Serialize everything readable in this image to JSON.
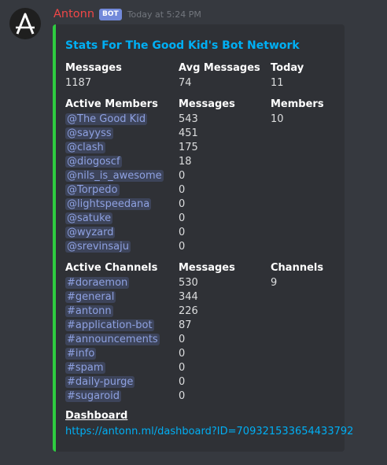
{
  "message": {
    "author": "Antonn",
    "bot_tag": "BOT",
    "timestamp": "Today at 5:24 PM",
    "avatar_icon": "letter-a-avatar-icon"
  },
  "colors": {
    "background": "#36393f",
    "embed_background": "#2f3136",
    "embed_border": "#2ecc40",
    "username": "#f04747",
    "link": "#00aff4",
    "mention": "#8ea1e1"
  },
  "embed": {
    "title": "Stats For The Good Kid's Bot Network",
    "stats": {
      "messages_label": "Messages",
      "messages_value": "1187",
      "avg_label": "Avg Messages",
      "avg_value": "74",
      "today_label": "Today",
      "today_value": "11"
    },
    "members_section": {
      "title": "Active Members",
      "count_header": "Messages",
      "total_label": "Members",
      "total_value": "10",
      "names": [
        "@The Good Kid",
        "@sayyss",
        "@clash",
        "@diogoscf",
        "@nils_is_awesome",
        "@Torpedo",
        "@lightspeedana",
        "@satuke",
        "@wyzard",
        "@srevinsaju"
      ],
      "counts": [
        "543",
        "451",
        "175",
        "18",
        "0",
        "0",
        "0",
        "0",
        "0",
        "0"
      ]
    },
    "channels_section": {
      "title": "Active Channels",
      "count_header": "Messages",
      "total_label": "Channels",
      "total_value": "9",
      "names": [
        "#doraemon",
        "#general",
        "#antonn",
        "#application-bot",
        "#announcements",
        "#info",
        "#spam",
        "#daily-purge",
        "#sugaroid"
      ],
      "counts": [
        "530",
        "344",
        "226",
        "87",
        "0",
        "0",
        "0",
        "0",
        "0"
      ]
    },
    "dashboard": {
      "title": "Dashboard",
      "url": "https://antonn.ml/dashboard?ID=709321533654433792"
    }
  }
}
